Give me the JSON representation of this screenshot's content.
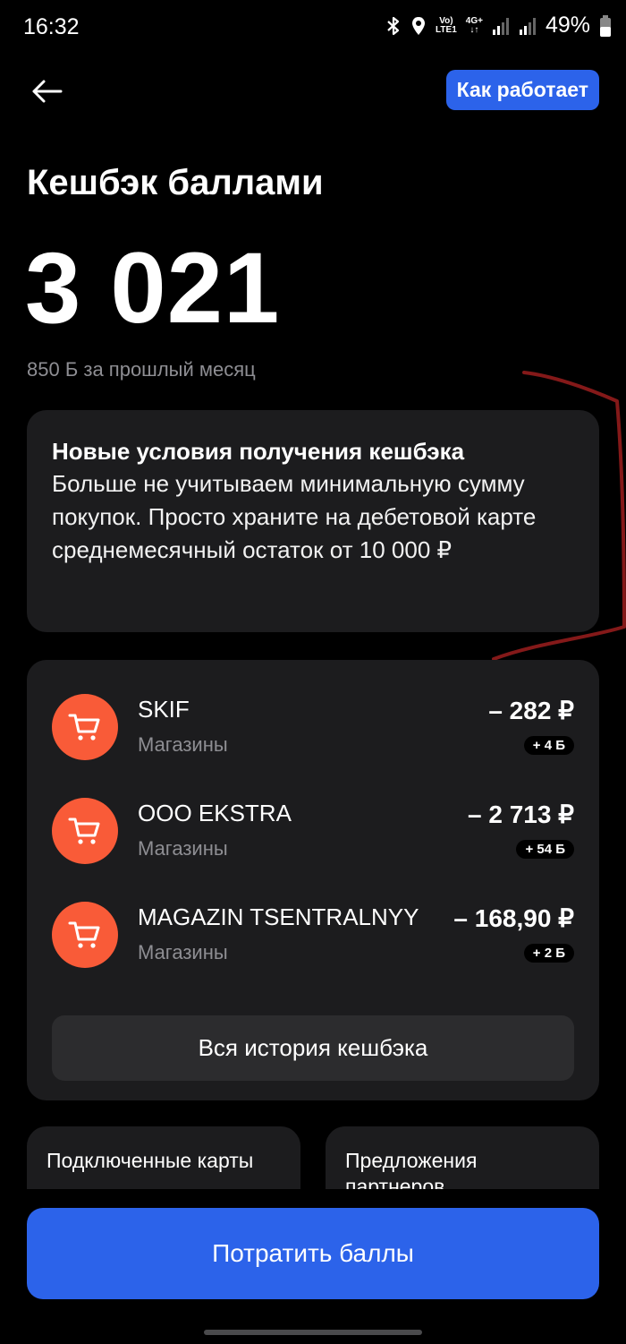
{
  "status_bar": {
    "time": "16:32",
    "net_top": "Vo)",
    "net_bottom": "LTE1",
    "gen_top": "4G+",
    "gen_bottom": "↓↑",
    "battery": "49%"
  },
  "header": {
    "how_it_works": "Как работает"
  },
  "title": "Кешбэк баллами",
  "balance": "3 021",
  "last_month": "850 Б за прошлый месяц",
  "info": {
    "title": "Новые условия получения кешбэка",
    "text": "Больше не учитываем минимальную сумму покупок. Просто храните на дебетовой карте среднемесячный остаток от 10 000 ₽"
  },
  "transactions": [
    {
      "name": "SKIF",
      "category": "Магазины",
      "amount": "– 282 ₽",
      "points": "+ 4 Б"
    },
    {
      "name": "ООО EKSTRA",
      "category": "Магазины",
      "amount": "– 2 713 ₽",
      "points": "+ 54 Б"
    },
    {
      "name": "MAGAZIN TSENTRALNYY",
      "category": "Магазины",
      "amount": "– 168,90 ₽",
      "points": "+ 2 Б"
    }
  ],
  "history_button": "Вся история кешбэка",
  "tiles": [
    {
      "label": "Подключенные карты"
    },
    {
      "label": "Предложения партнеров"
    }
  ],
  "spend_button": "Потратить баллы",
  "colors": {
    "accent": "#2c63ea",
    "card_bg": "#1c1c1e",
    "cart_icon": "#f95b38",
    "muted_text": "#8e8e93",
    "scribble": "#8b1a1a"
  },
  "icons": {
    "back": "arrow-left-icon",
    "cart": "shopping-cart-icon",
    "bluetooth": "bluetooth-icon",
    "location": "location-icon",
    "signal": "signal-icon",
    "battery": "battery-icon"
  }
}
